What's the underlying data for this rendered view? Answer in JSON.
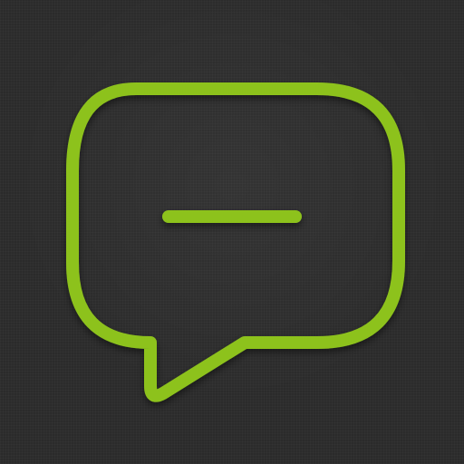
{
  "icon": {
    "name": "chat-bubble-minus-icon",
    "colors": {
      "background": "#2b2b2b",
      "stroke": "#8dc21f"
    }
  }
}
